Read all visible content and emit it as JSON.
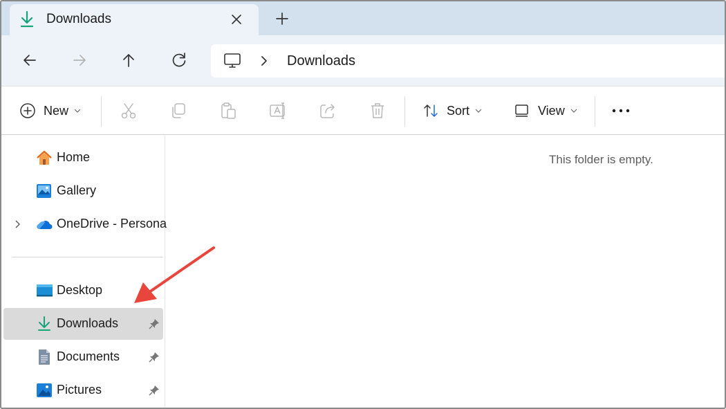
{
  "tab": {
    "title": "Downloads",
    "close_icon": "close-icon",
    "new_tab_icon": "plus-icon"
  },
  "nav": {
    "back": "arrow-left-icon",
    "forward": "arrow-right-icon",
    "up": "arrow-up-icon",
    "refresh": "refresh-icon"
  },
  "address": {
    "root_icon": "monitor-icon",
    "crumb": "Downloads"
  },
  "toolbar": {
    "new_label": "New",
    "sort_label": "Sort",
    "view_label": "View",
    "icons": [
      "plus-circle-icon",
      "cut-icon",
      "copy-icon",
      "paste-icon",
      "rename-icon",
      "share-icon",
      "delete-icon",
      "sort-icon",
      "view-icon",
      "more-icon"
    ]
  },
  "sidebar": {
    "items": [
      {
        "label": "Home",
        "icon": "home-icon"
      },
      {
        "label": "Gallery",
        "icon": "gallery-icon"
      },
      {
        "label": "OneDrive - Persona",
        "icon": "onedrive-icon"
      },
      {
        "label": "Desktop",
        "icon": "desktop-icon"
      },
      {
        "label": "Downloads",
        "icon": "download-icon",
        "selected": true
      },
      {
        "label": "Documents",
        "icon": "documents-icon"
      },
      {
        "label": "Pictures",
        "icon": "pictures-icon"
      }
    ]
  },
  "main": {
    "empty_text": "This folder is empty."
  },
  "colors": {
    "accent_green": "#17a37a",
    "onedrive_blue": "#0a6fd6",
    "annotation_arrow": "#e8453c",
    "tab_strip": "#d3e1ee",
    "nav_bg": "#eef3f9",
    "selected_bg": "#dadada"
  }
}
